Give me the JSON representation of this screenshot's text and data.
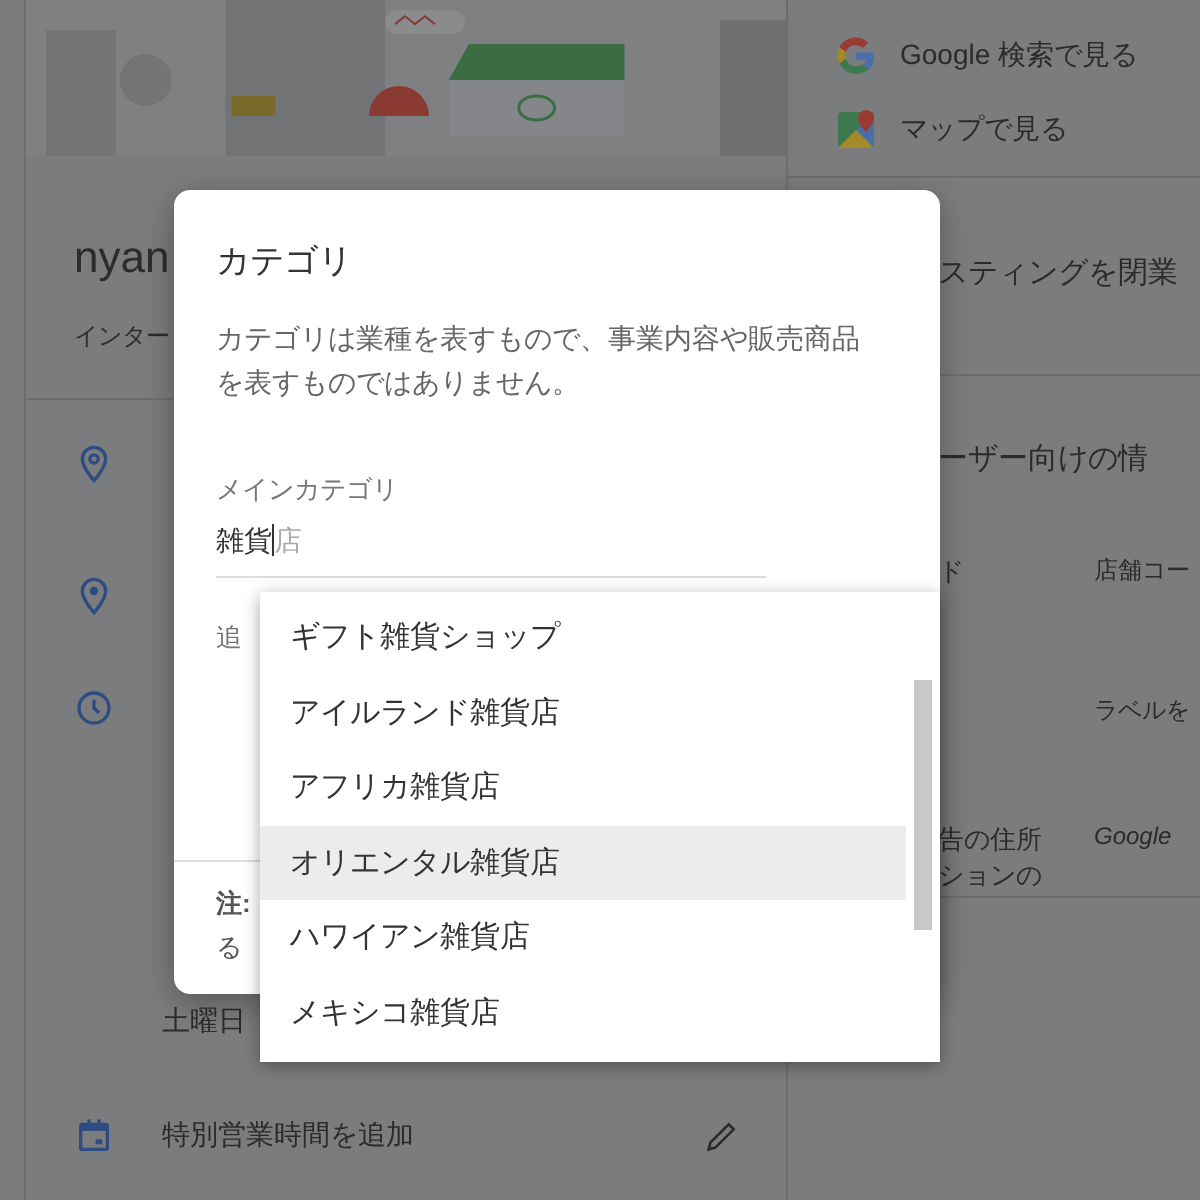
{
  "background": {
    "business_name": "nyan",
    "subtitle": "インター",
    "hours_last_day": "土曜日",
    "special_hours": "特別営業時間を追加",
    "links": [
      {
        "label": "Google 検索で見る",
        "kind": "google"
      },
      {
        "label": "マップで見る",
        "kind": "maps"
      }
    ],
    "close_listing": "スティングを閉業",
    "section_heading": "ーザー向けの情",
    "fields": [
      {
        "label_lines": [
          "ド"
        ],
        "value": "店舗コー",
        "italic": false
      },
      {
        "value": "ラベルを",
        "italic": false
      },
      {
        "label_lines": [
          "告の住所",
          "ションの"
        ],
        "value": "Google",
        "italic": true
      }
    ]
  },
  "dialog": {
    "title": "カテゴリ",
    "description": "カテゴリは業種を表すもので、事業内容や販売商品を表すものではありません。",
    "field_label": "メインカテゴリ",
    "field_value": "雑貨",
    "suggestion": "店",
    "additional_label": "追",
    "note_label": "注:",
    "note_text": "る"
  },
  "dropdown": {
    "options": [
      {
        "label": "ギフト雑貨ショップ",
        "selected": false
      },
      {
        "label": "アイルランド雑貨店",
        "selected": false
      },
      {
        "label": "アフリカ雑貨店",
        "selected": false
      },
      {
        "label": "オリエンタル雑貨店",
        "selected": true
      },
      {
        "label": "ハワイアン雑貨店",
        "selected": false
      },
      {
        "label": "メキシコ雑貨店",
        "selected": false
      }
    ]
  }
}
